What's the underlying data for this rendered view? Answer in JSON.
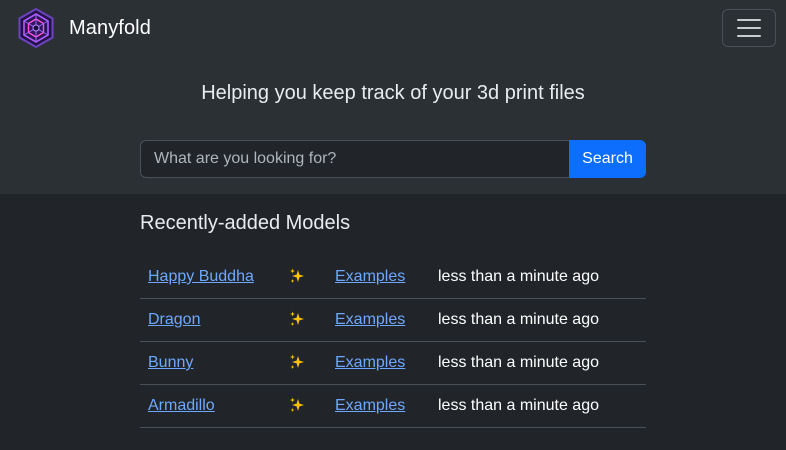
{
  "navbar": {
    "brand_name": "Manyfold",
    "logo_icon": "manyfold-logo-icon",
    "menu_icon": "hamburger-menu-icon"
  },
  "hero": {
    "tagline": "Helping you keep track of your 3d print files",
    "search": {
      "placeholder": "What are you looking for?",
      "value": "",
      "button_label": "Search"
    }
  },
  "recent": {
    "title": "Recently-added Models",
    "rows": [
      {
        "name": "Happy Buddha",
        "icon": "sparkles-icon",
        "library": "Examples",
        "time": "less than a minute ago"
      },
      {
        "name": "Dragon",
        "icon": "sparkles-icon",
        "library": "Examples",
        "time": "less than a minute ago"
      },
      {
        "name": "Bunny",
        "icon": "sparkles-icon",
        "library": "Examples",
        "time": "less than a minute ago"
      },
      {
        "name": "Armadillo",
        "icon": "sparkles-icon",
        "library": "Examples",
        "time": "less than a minute ago"
      }
    ]
  },
  "colors": {
    "page_background": "#212529",
    "navbar_background": "#2b3035",
    "accent": "#0d6efd",
    "link": "#6ea8fe",
    "sparkle": "#ffc107"
  }
}
